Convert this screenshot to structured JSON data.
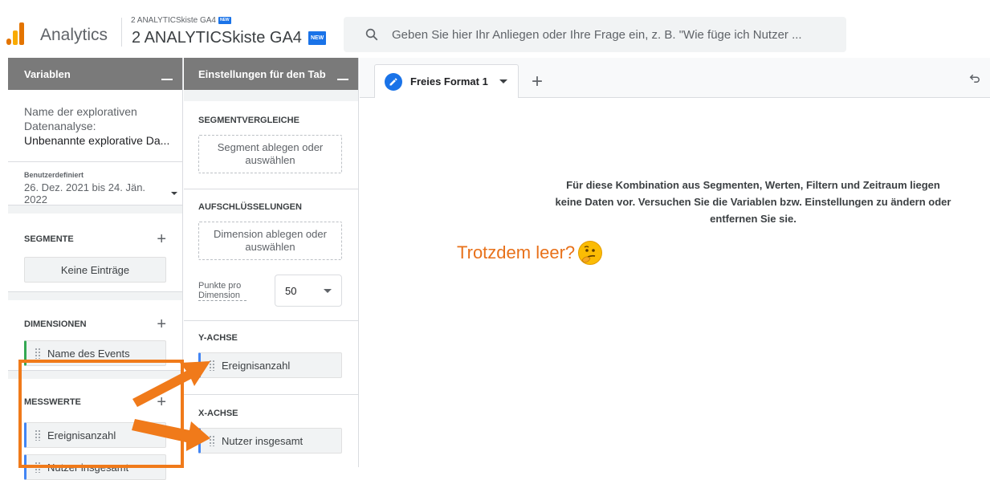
{
  "header": {
    "app_name": "Analytics",
    "property_small": "2 ANALYTICSkiste GA4",
    "property_big": "2 ANALYTICSkiste GA4",
    "badge": "NEW",
    "search_placeholder": "Geben Sie hier Ihr Anliegen oder Ihre Frage ein, z. B. \"Wie füge ich Nutzer ..."
  },
  "variables_panel": {
    "title": "Variablen",
    "exploration_name_label": "Name der explorativen Datenanalyse:",
    "exploration_name_value": "Unbenannte explorative Da...",
    "date_label": "Benutzerdefiniert",
    "date_range": "26. Dez. 2021 bis 24. Jän. 2022",
    "segments_title": "SEGMENTE",
    "segments_empty": "Keine Einträge",
    "dimensions_title": "DIMENSIONEN",
    "dimensions": [
      "Name des Events"
    ],
    "metrics_title": "MESSWERTE",
    "metrics": [
      "Ereignisanzahl",
      "Nutzer insgesamt"
    ]
  },
  "tab_settings_panel": {
    "title": "Einstellungen für den Tab",
    "segment_compare_title": "SEGMENTVERGLEICHE",
    "segment_drop": "Segment ablegen oder auswählen",
    "breakdowns_title": "AUFSCHLÜSSELUNGEN",
    "dimension_drop": "Dimension ablegen oder auswählen",
    "points_label": "Punkte pro Dimension",
    "points_value": "50",
    "y_axis_title": "Y-ACHSE",
    "y_axis_chip": "Ereignisanzahl",
    "x_axis_title": "X-ACHSE",
    "x_axis_chip": "Nutzer insgesamt"
  },
  "canvas": {
    "tab_label": "Freies Format 1",
    "empty_message": "Für diese Kombination aus Segmenten, Werten, Filtern und Zeitraum liegen keine Daten vor. Versuchen Sie die Variablen bzw. Einstellungen zu ändern oder entfernen Sie sie.",
    "annotation": "Trotzdem leer?"
  },
  "colors": {
    "accent": "#1a73e8",
    "annotation_orange": "#f07a1a",
    "panel_header": "#7a7a7a",
    "logo_orange": "#f9ab00",
    "logo_dark": "#e37400"
  }
}
